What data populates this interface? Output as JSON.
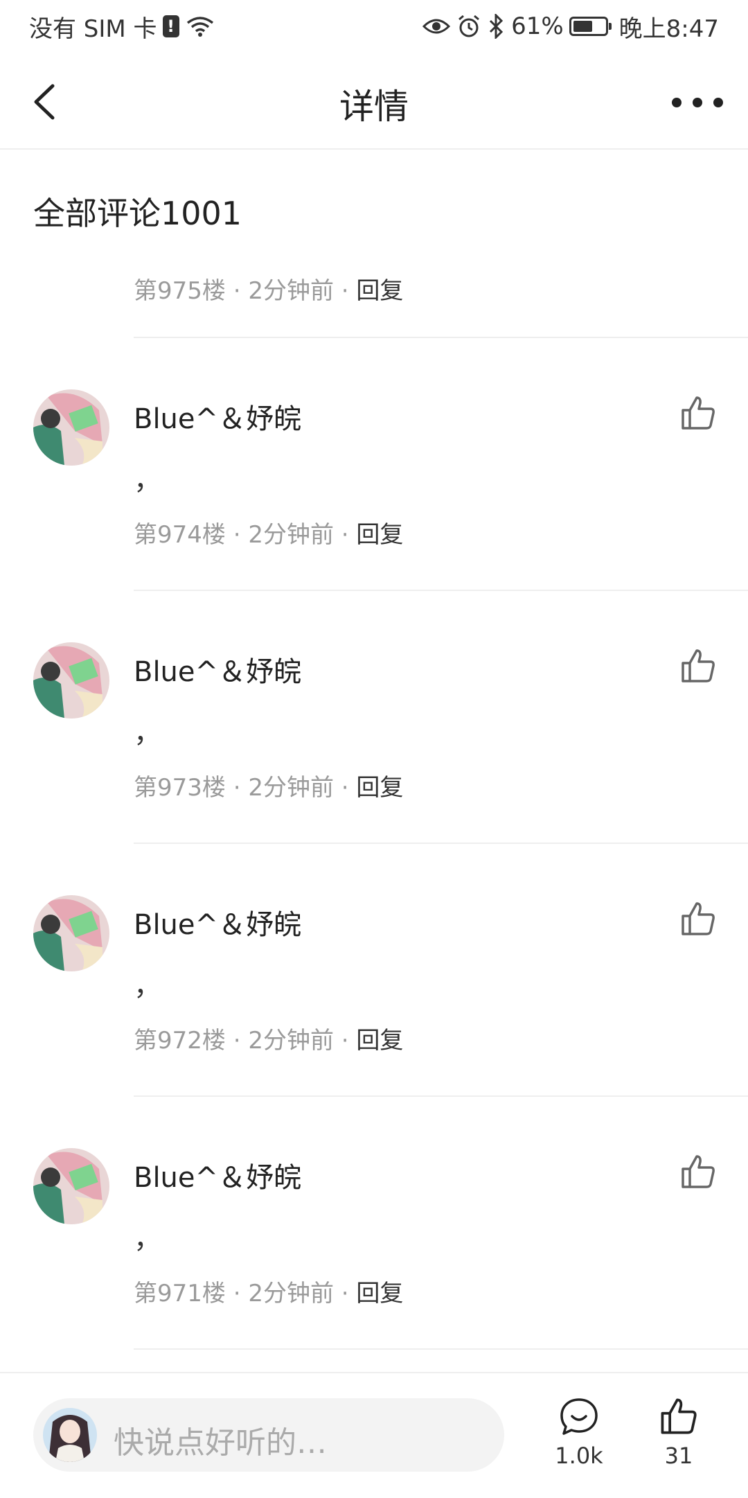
{
  "status_bar": {
    "carrier": "没有 SIM 卡",
    "battery": "61%",
    "battery_level": 0.61,
    "time": "晚上8:47"
  },
  "header": {
    "title": "详情",
    "back_icon": "chevron-left-icon",
    "more_icon": "more-horizontal-icon"
  },
  "section_title": "全部评论1001",
  "first_item": {
    "floor": "第975楼",
    "time": "2分钟前",
    "reply": "回复"
  },
  "comments": [
    {
      "username": "Blue^＆妤皖",
      "text": "，",
      "floor": "第974楼",
      "time": "2分钟前",
      "reply": "回复"
    },
    {
      "username": "Blue^＆妤皖",
      "text": "，",
      "floor": "第973楼",
      "time": "2分钟前",
      "reply": "回复"
    },
    {
      "username": "Blue^＆妤皖",
      "text": "，",
      "floor": "第972楼",
      "time": "2分钟前",
      "reply": "回复"
    },
    {
      "username": "Blue^＆妤皖",
      "text": "，",
      "floor": "第971楼",
      "time": "2分钟前",
      "reply": "回复"
    }
  ],
  "separator": "·",
  "bottom_bar": {
    "placeholder": "快说点好听的…",
    "comment_count": "1.0k",
    "like_count": "31"
  },
  "colors": {
    "meta_text": "#9a9a9a",
    "divider": "#eeeeee",
    "input_bg": "#f3f3f3"
  }
}
